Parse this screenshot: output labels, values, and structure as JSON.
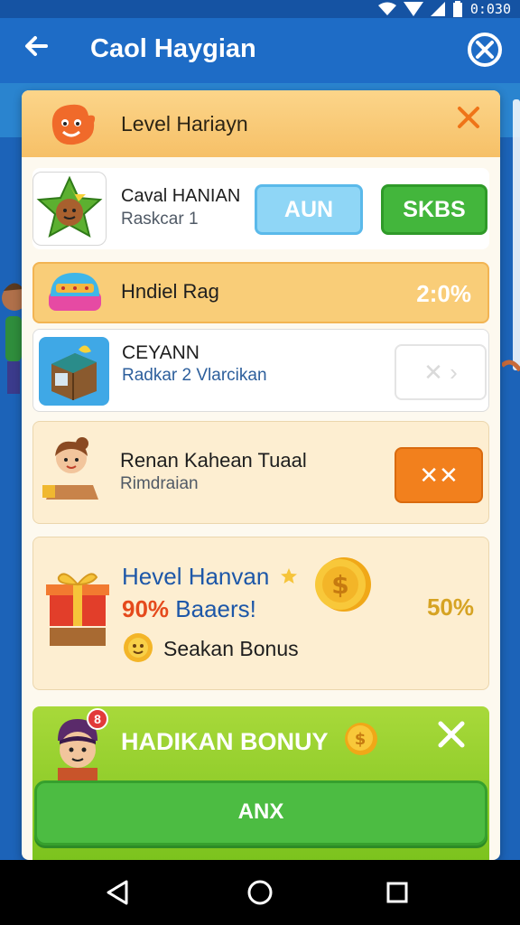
{
  "status_bar": {
    "time": "0:030"
  },
  "app_bar": {
    "title": "Caol Haygian"
  },
  "panel": {
    "header_title": "Level Hariayn",
    "rows": [
      {
        "title": "Caval HANIAN",
        "subtitle": "Raskcar 1",
        "button_primary": "AUN",
        "button_secondary": "SKBS"
      },
      {
        "title": "Hndiel Rag",
        "value": "2:0%"
      },
      {
        "title": "CEYANN",
        "subtitle": "Radkar 2 Vlarcikan",
        "button_label": "✕ ›"
      },
      {
        "title": "Renan Kahean Tuaal",
        "subtitle": "Rimdraian",
        "button_label": "✕✕"
      },
      {
        "title": "Hevel Hanvan",
        "promo_pct": "90%",
        "promo_text": "Baaers!",
        "bonus_label": "Seakan Bonus",
        "value": "50%"
      }
    ],
    "bonus_banner": {
      "title": "HADIKAN BONUY",
      "badge": "8",
      "cta_label": "ANX"
    }
  },
  "colors": {
    "brand_blue": "#1e6cc6",
    "accent_orange": "#f2801d",
    "accent_green": "#43b63c"
  }
}
